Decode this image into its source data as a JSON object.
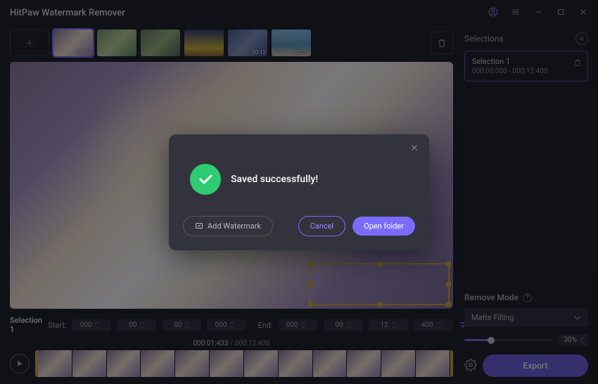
{
  "app": {
    "title": "HitPaw Watermark Remover"
  },
  "thumbs": [
    {
      "duration": "00:12",
      "selected": true
    },
    {
      "duration": ""
    },
    {
      "duration": ""
    },
    {
      "duration": ""
    },
    {
      "duration": "00:12"
    },
    {
      "duration": "00:15"
    }
  ],
  "timebar": {
    "selection_label": "Selection 1",
    "start_label": "Start:",
    "end_label": "End:",
    "start": {
      "h": "000",
      "m": "00",
      "s": "00",
      "ms": "000"
    },
    "end": {
      "h": "000",
      "m": "00",
      "s": "12",
      "ms": "400"
    }
  },
  "playhead": {
    "current": "000:01:433",
    "sep": " / ",
    "total": "000:12:400"
  },
  "sidebar": {
    "header": "Selections",
    "items": [
      {
        "name": "Selection 1",
        "range": "000:00:000 - 000:12:400"
      }
    ]
  },
  "remove_mode": {
    "header": "Remove Mode",
    "dropdown": "Matte Filling",
    "percent": "30%"
  },
  "export_label": "Export",
  "modal": {
    "message": "Saved successfully!",
    "add_watermark": "Add Watermark",
    "cancel": "Cancel",
    "open_folder": "Open folder"
  }
}
